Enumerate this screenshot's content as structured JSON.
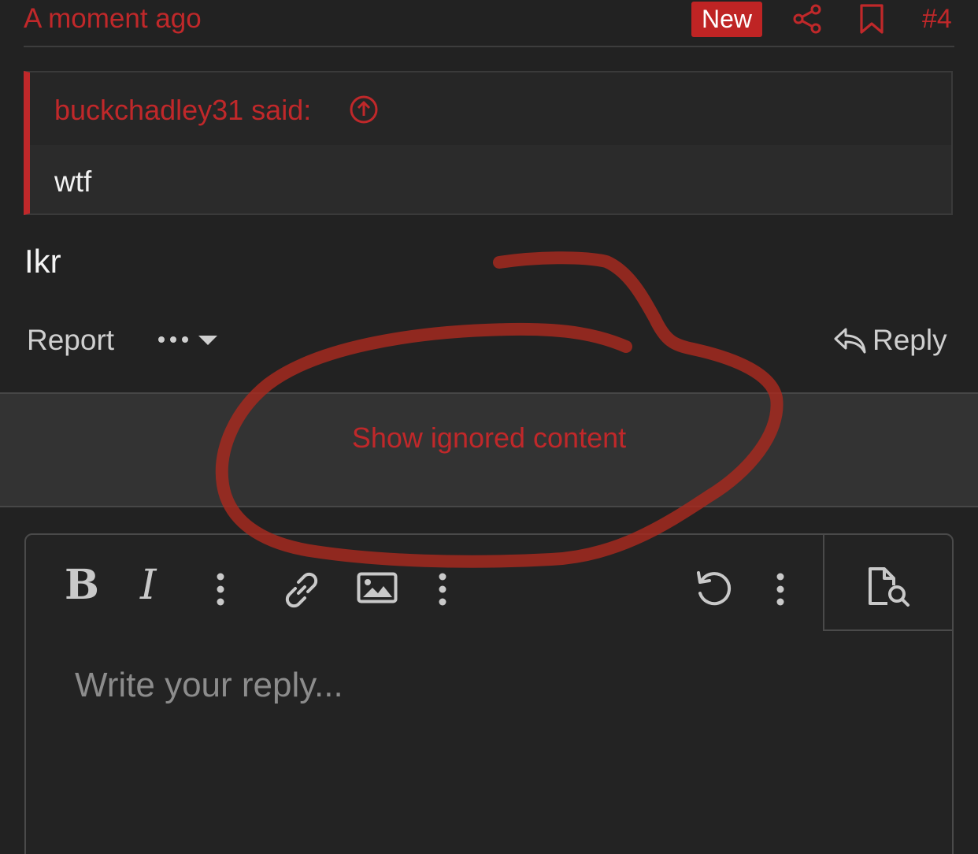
{
  "post": {
    "timestamp": "A moment ago",
    "badge": "New",
    "number": "#4",
    "quote": {
      "author": "buckchadley31 said:",
      "text": "wtf"
    },
    "body": "Ikr",
    "actions": {
      "report": "Report",
      "reply": "Reply"
    }
  },
  "ignored": {
    "link": "Show ignored content"
  },
  "editor": {
    "bold": "B",
    "italic": "I",
    "placeholder": "Write your reply..."
  },
  "colors": {
    "accent": "#c0282a",
    "background": "#222222",
    "annotation": "#a82a1f"
  },
  "icons": [
    "share-icon",
    "bookmark-icon",
    "arrow-up-circle-icon",
    "ellipsis-icon",
    "caret-down-icon",
    "reply-arrow-icon",
    "more-vertical-icon",
    "link-icon",
    "image-icon",
    "undo-icon",
    "preview-icon"
  ]
}
